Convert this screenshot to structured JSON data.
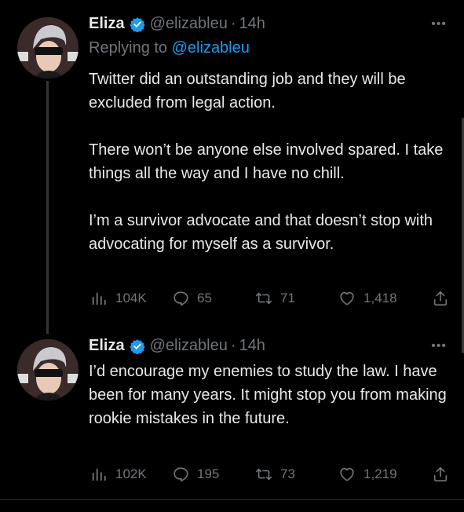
{
  "colors": {
    "accent": "#1d9bf0",
    "muted": "#71767b",
    "text": "#e7e9ea",
    "background": "#000000"
  },
  "tweets": [
    {
      "name": "Eliza",
      "verified_icon": "verified-badge-icon",
      "handle": "@elizableu",
      "separator": "·",
      "time": "14h",
      "more": "•••",
      "replying_label": "Replying to",
      "replying_to": "@elizableu",
      "paragraphs": [
        "Twitter did an outstanding job and they will be excluded from legal action.",
        "There won’t be anyone else involved spared. I take things all the way and I have no chill.",
        "I’m a survivor advocate and that doesn’t stop with advocating for myself as a survivor."
      ],
      "stats": {
        "views": "104K",
        "replies": "65",
        "retweets": "71",
        "likes": "1,418"
      }
    },
    {
      "name": "Eliza",
      "verified_icon": "verified-badge-icon",
      "handle": "@elizableu",
      "separator": "·",
      "time": "14h",
      "more": "•••",
      "paragraphs": [
        "I’d encourage my enemies to study the law. I have been for many years. It might stop you from making rookie mistakes in the future."
      ],
      "stats": {
        "views": "102K",
        "replies": "195",
        "retweets": "73",
        "likes": "1,219"
      }
    }
  ]
}
